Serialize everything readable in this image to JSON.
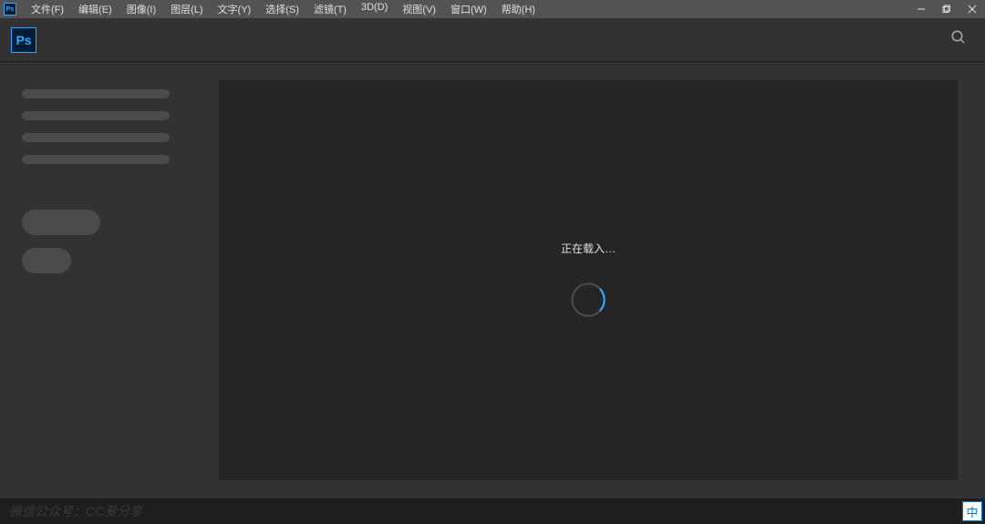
{
  "titlebar": {
    "app_icon": "Ps"
  },
  "menu": {
    "items": [
      {
        "label": "文件(F)"
      },
      {
        "label": "编辑(E)"
      },
      {
        "label": "图像(I)"
      },
      {
        "label": "图层(L)"
      },
      {
        "label": "文字(Y)"
      },
      {
        "label": "选择(S)"
      },
      {
        "label": "滤镜(T)"
      },
      {
        "label": "3D(D)"
      },
      {
        "label": "视图(V)"
      },
      {
        "label": "窗口(W)"
      },
      {
        "label": "帮助(H)"
      }
    ]
  },
  "logo": {
    "text": "Ps"
  },
  "loading": {
    "text": "正在载入…"
  },
  "watermark": {
    "text": "微信公众号：CC爱分享"
  },
  "ime": {
    "label": "中"
  },
  "colors": {
    "accent": "#31a8ff",
    "bg_dark": "#252525",
    "bg_mid": "#323232",
    "bg_titlebar": "#535353"
  }
}
